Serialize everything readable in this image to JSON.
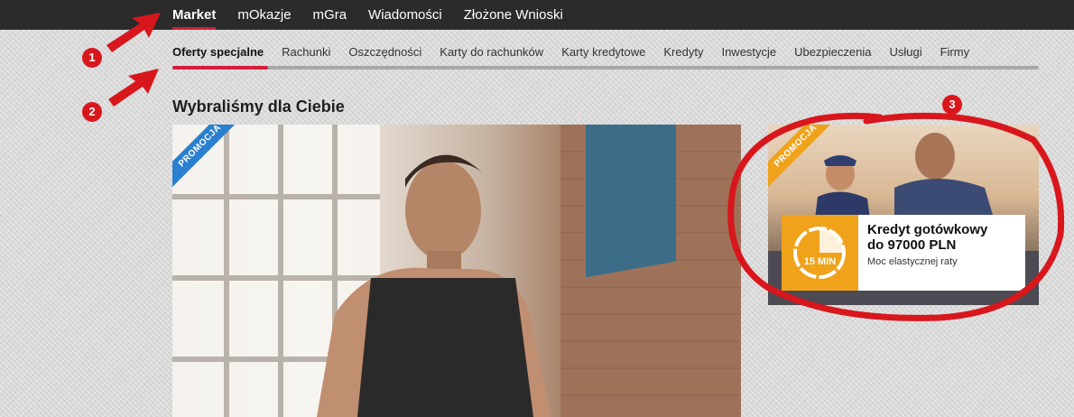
{
  "topnav": {
    "items": [
      {
        "label": "Market",
        "active": true
      },
      {
        "label": "mOkazje"
      },
      {
        "label": "mGra"
      },
      {
        "label": "Wiadomości"
      },
      {
        "label": "Złożone Wnioski"
      }
    ]
  },
  "subnav": {
    "items": [
      {
        "label": "Oferty specjalne",
        "active": true
      },
      {
        "label": "Rachunki"
      },
      {
        "label": "Oszczędności"
      },
      {
        "label": "Karty do rachunków"
      },
      {
        "label": "Karty kredytowe"
      },
      {
        "label": "Kredyty"
      },
      {
        "label": "Inwestycje"
      },
      {
        "label": "Ubezpieczenia"
      },
      {
        "label": "Usługi"
      },
      {
        "label": "Firmy"
      }
    ]
  },
  "main": {
    "section_title": "Wybraliśmy dla Ciebie",
    "hero": {
      "ribbon": "PROMOCJA"
    }
  },
  "promo": {
    "ribbon": "PROMOCJA",
    "icon_label": "15 MIN",
    "title_line1": "Kredyt gotówkowy",
    "title_line2": "do 97000 PLN",
    "subtitle": "Moc elastycznej raty"
  },
  "annotations": {
    "badge1": "1",
    "badge2": "2",
    "badge3": "3"
  },
  "colors": {
    "accent": "#d21f3c",
    "annotation_red": "#d8171d",
    "promo_orange": "#f0a21a",
    "ribbon_blue": "#2a7fcf",
    "topbar": "#2b2b2b"
  }
}
